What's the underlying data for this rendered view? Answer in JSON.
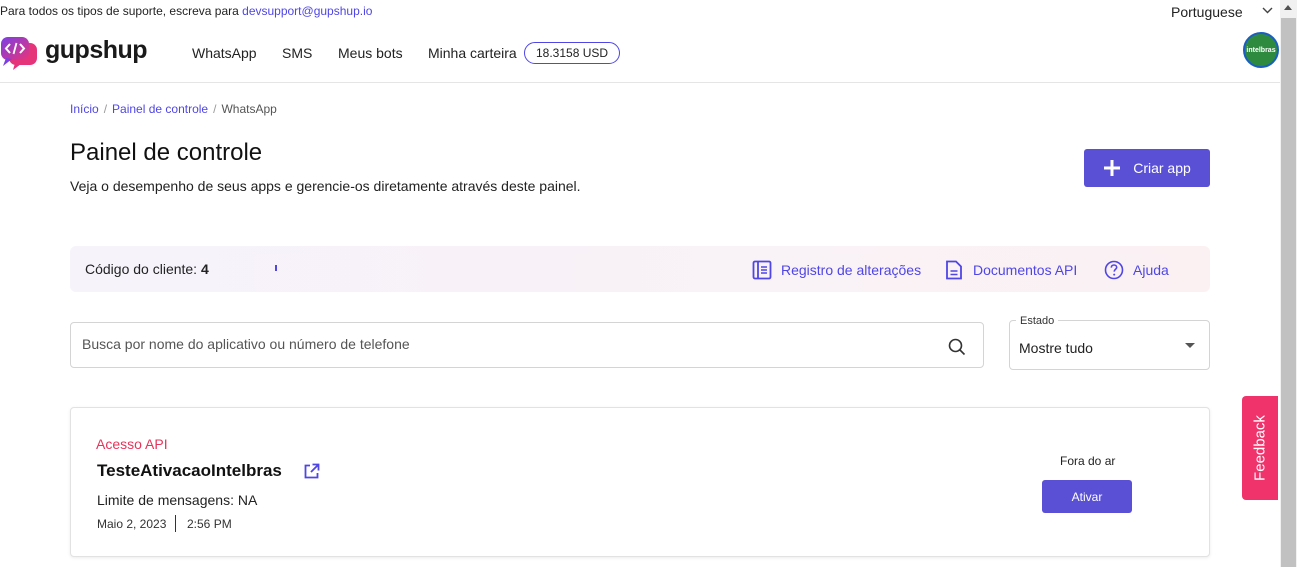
{
  "topbar": {
    "support_text": "Para todos os tipos de suporte, escreva para ",
    "support_email": "devsupport@gupshup.io",
    "language": "Portuguese"
  },
  "header": {
    "logo_text": "gupshup",
    "nav": [
      "WhatsApp",
      "SMS",
      "Meus bots",
      "Minha carteira"
    ],
    "wallet_balance": "18.3158 USD",
    "avatar_text": "intelbras"
  },
  "breadcrumb": {
    "items": [
      "Início",
      "Painel de controle"
    ],
    "current": "WhatsApp"
  },
  "page": {
    "title": "Painel de controle",
    "subtitle": "Veja o desempenho de seus apps e gerencie-os diretamente através deste painel.",
    "create_button": "Criar app"
  },
  "client_bar": {
    "label": "Código do cliente: ",
    "value": "4",
    "links": [
      {
        "label": "Registro de alterações",
        "icon": "changelog-icon"
      },
      {
        "label": "Documentos API",
        "icon": "document-icon"
      },
      {
        "label": "Ajuda",
        "icon": "help-icon"
      }
    ]
  },
  "search": {
    "placeholder": "Busca por nome do aplicativo ou número de telefone",
    "value": ""
  },
  "status_filter": {
    "label": "Estado",
    "value": "Mostre tudo"
  },
  "apps": [
    {
      "type": "Acesso API",
      "name": "TesteAtivacaoIntelbras",
      "limit": "Limite de mensagens: NA",
      "date": "Maio 2, 2023",
      "time": "2:56 PM",
      "status": "Fora do ar",
      "action": "Ativar"
    }
  ],
  "feedback": "Feedback",
  "colors": {
    "accent": "#5a50d6",
    "link": "#4f46e5",
    "app_type": "#e5355b",
    "feedback": "#f0336b"
  }
}
